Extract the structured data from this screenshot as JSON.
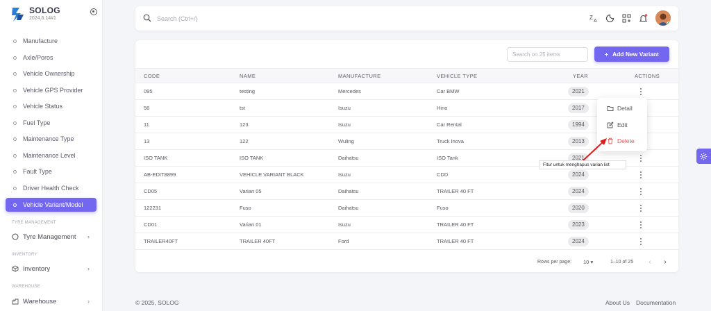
{
  "brand": {
    "name": "SOLOG",
    "version": "2024.6.14#1"
  },
  "sidebar": {
    "items": [
      {
        "label": "Manufacture"
      },
      {
        "label": "Axle/Poros"
      },
      {
        "label": "Vehicle Ownership"
      },
      {
        "label": "Vehicle GPS Provider"
      },
      {
        "label": "Vehicle Status"
      },
      {
        "label": "Fuel Type"
      },
      {
        "label": "Maintenance Type"
      },
      {
        "label": "Maintenance Level"
      },
      {
        "label": "Fault Type"
      },
      {
        "label": "Driver Health Check"
      },
      {
        "label": "Vehicle Variant/Model",
        "active": true
      }
    ],
    "sections": [
      {
        "title": "TYRE MANAGEMENT",
        "item": "Tyre Management",
        "icon": "circle-icon"
      },
      {
        "title": "INVENTORY",
        "item": "Inventory",
        "icon": "box-icon"
      },
      {
        "title": "WAREHOUSE",
        "item": "Warehouse",
        "icon": "warehouse-icon"
      }
    ]
  },
  "topbar": {
    "search_placeholder": "Search (Ctrl+/)"
  },
  "table": {
    "search_placeholder": "Search on 25 items",
    "add_button": "Add New Variant",
    "headers": [
      "CODE",
      "NAME",
      "MANUFACTURE",
      "VEHICLE TYPE",
      "YEAR",
      "ACTIONS"
    ],
    "rows": [
      {
        "code": "095",
        "name": "testing",
        "manufacture": "Mercedes",
        "vehicle_type": "Car BMW",
        "year": "2021"
      },
      {
        "code": "56",
        "name": "tst",
        "manufacture": "Isuzu",
        "vehicle_type": "Hino",
        "year": "2017"
      },
      {
        "code": "11",
        "name": "123",
        "manufacture": "Isuzu",
        "vehicle_type": "Car Rental",
        "year": "1994"
      },
      {
        "code": "13",
        "name": "122",
        "manufacture": "Wuling",
        "vehicle_type": "Truck Inova",
        "year": "2013"
      },
      {
        "code": "ISO TANK",
        "name": "ISO TANK",
        "manufacture": "Daihatsu",
        "vehicle_type": "ISO Tank",
        "year": "2021"
      },
      {
        "code": "AB-EDIT8899",
        "name": "VEHICLE VARIANT BLACK",
        "manufacture": "Isuzu",
        "vehicle_type": "CDD",
        "year": "2024"
      },
      {
        "code": "CD05",
        "name": "Varian 05",
        "manufacture": "Daihatsu",
        "vehicle_type": "TRAILER 40 FT",
        "year": "2024"
      },
      {
        "code": "122231",
        "name": "Fuso",
        "manufacture": "Daihatsu",
        "vehicle_type": "Fuso",
        "year": "2020"
      },
      {
        "code": "CD01",
        "name": "Varian 01",
        "manufacture": "Isuzu",
        "vehicle_type": "TRAILER 40 FT",
        "year": "2023"
      },
      {
        "code": "TRAILER40FT",
        "name": "TRAILER 40FT",
        "manufacture": "Ford",
        "vehicle_type": "TRAILER 40 FT",
        "year": "2024"
      }
    ],
    "pagination": {
      "rows_per_page_label": "Rows per page:",
      "rows_per_page": "10",
      "range": "1–10 of 25"
    }
  },
  "dropdown": {
    "items": [
      "Detail",
      "Edit",
      "Delete"
    ]
  },
  "annotation": {
    "text": "Fitur untuk menghapus varian list"
  },
  "footer": {
    "copyright": "© 2025, SOLOG",
    "about": "About Us",
    "docs": "Documentation"
  },
  "colors": {
    "primary": "#7367f0",
    "danger": "#ea5455",
    "online": "#28c76f"
  }
}
